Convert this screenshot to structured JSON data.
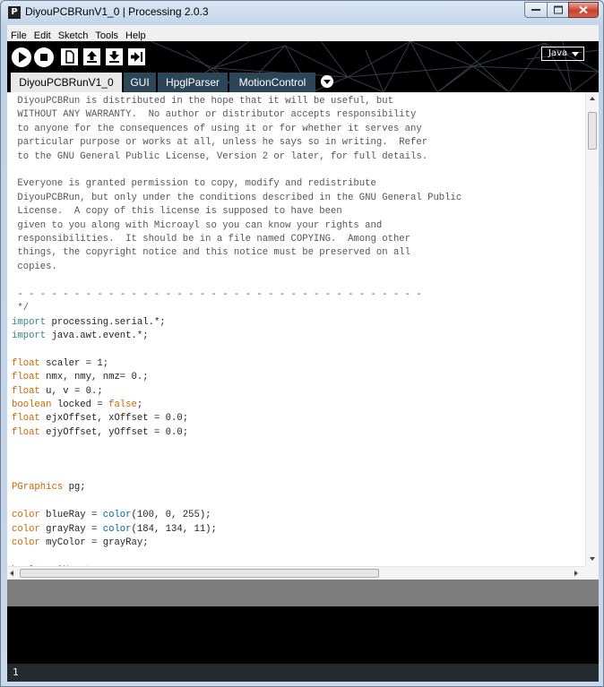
{
  "window": {
    "title": "DiyouPCBRunV1_0 | Processing 2.0.3",
    "app_icon_letter": "P"
  },
  "menu": [
    "File",
    "Edit",
    "Sketch",
    "Tools",
    "Help"
  ],
  "toolbar": {
    "buttons": [
      "run",
      "stop",
      "new",
      "open",
      "save",
      "export"
    ],
    "mode": "Java"
  },
  "tabs": [
    "DiyouPCBRunV1_0",
    "GUI",
    "HpglParser",
    "MotionControl"
  ],
  "editor": {
    "lines": [
      [
        {
          "t": " DiyouPCBRun is distributed in the hope that it will be useful, but",
          "c": "cm"
        }
      ],
      [
        {
          "t": " WITHOUT ANY WARRANTY.  No author or distributor accepts responsibility",
          "c": "cm"
        }
      ],
      [
        {
          "t": " to anyone for the consequences of using it or for whether it serves any",
          "c": "cm"
        }
      ],
      [
        {
          "t": " particular purpose or works at all, unless he says so in writing.  Refer",
          "c": "cm"
        }
      ],
      [
        {
          "t": " to the GNU General Public License, Version 2 or later, for full details.",
          "c": "cm"
        }
      ],
      [
        {
          "t": "",
          "c": "cm"
        }
      ],
      [
        {
          "t": " Everyone is granted permission to copy, modify and redistribute",
          "c": "cm"
        }
      ],
      [
        {
          "t": " DiyouPCBRun, but only under the conditions described in the GNU General Public",
          "c": "cm"
        }
      ],
      [
        {
          "t": " License.  A copy of this license is supposed to have been",
          "c": "cm"
        }
      ],
      [
        {
          "t": " given to you along with Microayl so you can know your rights and",
          "c": "cm"
        }
      ],
      [
        {
          "t": " responsibilities.  It should be in a file named COPYING.  Among other",
          "c": "cm"
        }
      ],
      [
        {
          "t": " things, the copyright notice and this notice must be preserved on all",
          "c": "cm"
        }
      ],
      [
        {
          "t": " copies.",
          "c": "cm"
        }
      ],
      [
        {
          "t": "",
          "c": "cm"
        }
      ],
      [
        {
          "t": " - - - - - - - - - - - - - - - - - - - - - - - - - - - - - - - - - - - -",
          "c": "cm"
        }
      ],
      [
        {
          "t": " */",
          "c": "cm"
        }
      ],
      [
        {
          "t": "import",
          "c": "kw"
        },
        {
          "t": " processing.serial.*;",
          "c": ""
        }
      ],
      [
        {
          "t": "import",
          "c": "kw"
        },
        {
          "t": " java.awt.event.*;",
          "c": ""
        }
      ],
      [
        {
          "t": "",
          "c": ""
        }
      ],
      [
        {
          "t": "float",
          "c": "kw2"
        },
        {
          "t": " scaler = 1;",
          "c": ""
        }
      ],
      [
        {
          "t": "float",
          "c": "kw2"
        },
        {
          "t": " nmx, nmy, nmz= 0.;",
          "c": ""
        }
      ],
      [
        {
          "t": "float",
          "c": "kw2"
        },
        {
          "t": " u, v = 0.;",
          "c": ""
        }
      ],
      [
        {
          "t": "boolean",
          "c": "kw2"
        },
        {
          "t": " locked = ",
          "c": ""
        },
        {
          "t": "false",
          "c": "kw2"
        },
        {
          "t": ";",
          "c": ""
        }
      ],
      [
        {
          "t": "float",
          "c": "kw2"
        },
        {
          "t": " ejxOffset, xOffset = 0.0;",
          "c": ""
        }
      ],
      [
        {
          "t": "float",
          "c": "kw2"
        },
        {
          "t": " ejyOffset, yOffset = 0.0;",
          "c": ""
        }
      ],
      [
        {
          "t": "",
          "c": ""
        }
      ],
      [
        {
          "t": "",
          "c": ""
        }
      ],
      [
        {
          "t": "",
          "c": ""
        }
      ],
      [
        {
          "t": "PGraphics",
          "c": "kw2"
        },
        {
          "t": " pg;",
          "c": ""
        }
      ],
      [
        {
          "t": "",
          "c": ""
        }
      ],
      [
        {
          "t": "color",
          "c": "kw2"
        },
        {
          "t": " blueRay = ",
          "c": ""
        },
        {
          "t": "color",
          "c": "fn"
        },
        {
          "t": "(100, 0, 255);",
          "c": ""
        }
      ],
      [
        {
          "t": "color",
          "c": "kw2"
        },
        {
          "t": " grayRay = ",
          "c": ""
        },
        {
          "t": "color",
          "c": "fn"
        },
        {
          "t": "(184, 134, 11);",
          "c": ""
        }
      ],
      [
        {
          "t": "color",
          "c": "kw2"
        },
        {
          "t": " myColor = grayRay;",
          "c": ""
        }
      ],
      [
        {
          "t": "",
          "c": ""
        }
      ],
      [
        {
          "t": "boolean",
          "c": "kw2"
        },
        {
          "t": " ON = ",
          "c": ""
        },
        {
          "t": "true",
          "c": "kw2"
        },
        {
          "t": ";",
          "c": ""
        }
      ]
    ]
  },
  "footer": {
    "line_number": "1"
  },
  "colors": {
    "toolbar_bg": "#000000",
    "tab_bg": "#2c4657",
    "active_tab_bg": "#e8e8e8",
    "status_bg": "#7d7d7d",
    "console_bg": "#000000",
    "footer_bg": "#252a2e"
  }
}
